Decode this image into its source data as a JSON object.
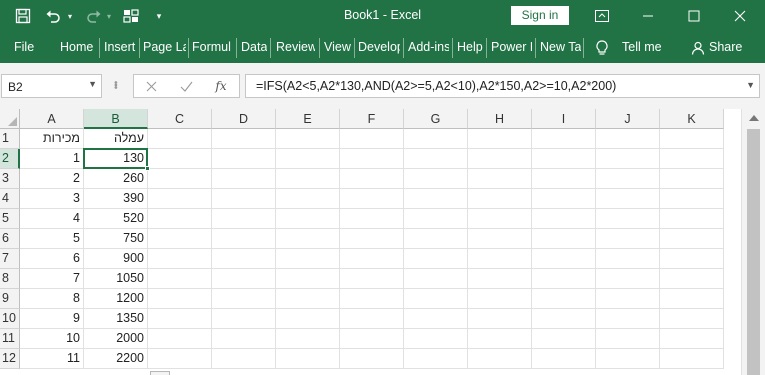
{
  "titlebar": {
    "title": "Book1  -  Excel",
    "signin_label": "Sign in",
    "icons": [
      "save-icon",
      "undo-icon",
      "undo-dropdown-icon",
      "redo-icon",
      "redo-dropdown-icon",
      "form-icon",
      "customize-qat-icon",
      "ribbon-display-icon",
      "minimize-icon",
      "maximize-icon",
      "close-icon"
    ]
  },
  "ribbon": {
    "tabs": [
      "File",
      "Home",
      "Insert",
      "Page La",
      "Formul",
      "Data",
      "Review",
      "View",
      "Develop",
      "Add-ins",
      "Help",
      "Power P",
      "New Ta"
    ],
    "tell_me": "Tell me",
    "share": "Share"
  },
  "formula_bar": {
    "name_box": "B2",
    "formula": "=IFS(A2<5,A2*130,AND(A2>=5,A2<10),A2*150,A2>=10,A2*200)"
  },
  "sheet": {
    "columns": [
      "A",
      "B",
      "C",
      "D",
      "E",
      "F",
      "G",
      "H",
      "I",
      "J",
      "K"
    ],
    "selected_column": "B",
    "selected_row": "2",
    "rows": [
      {
        "num": "1",
        "a": "מכירות",
        "b": "עמלה"
      },
      {
        "num": "2",
        "a": "1",
        "b": "130"
      },
      {
        "num": "3",
        "a": "2",
        "b": "260"
      },
      {
        "num": "4",
        "a": "3",
        "b": "390"
      },
      {
        "num": "5",
        "a": "4",
        "b": "520"
      },
      {
        "num": "6",
        "a": "5",
        "b": "750"
      },
      {
        "num": "7",
        "a": "6",
        "b": "900"
      },
      {
        "num": "8",
        "a": "7",
        "b": "1050"
      },
      {
        "num": "9",
        "a": "8",
        "b": "1200"
      },
      {
        "num": "10",
        "a": "9",
        "b": "1350"
      },
      {
        "num": "11",
        "a": "10",
        "b": "2000"
      },
      {
        "num": "12",
        "a": "11",
        "b": "2200"
      }
    ]
  },
  "colors": {
    "accent": "#217346",
    "selection_header": "#d3e5dc",
    "gridline": "#e1e1e1"
  }
}
